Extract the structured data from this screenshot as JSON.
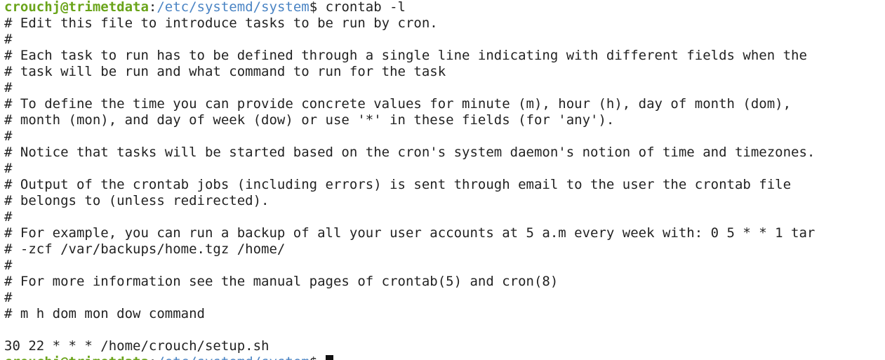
{
  "prompt": {
    "user_host": "crouchj@trimetdata",
    "separator": ":",
    "path": "/etc/systemd/system",
    "symbol": "$",
    "command": "crontab -l"
  },
  "output_lines": [
    "# Edit this file to introduce tasks to be run by cron.",
    "#",
    "# Each task to run has to be defined through a single line indicating with different fields when the",
    "# task will be run and what command to run for the task",
    "#",
    "# To define the time you can provide concrete values for minute (m), hour (h), day of month (dom),",
    "# month (mon), and day of week (dow) or use '*' in these fields (for 'any').",
    "#",
    "# Notice that tasks will be started based on the cron's system daemon's notion of time and timezones.",
    "#",
    "# Output of the crontab jobs (including errors) is sent through email to the user the crontab file",
    "# belongs to (unless redirected).",
    "#",
    "# For example, you can run a backup of all your user accounts at 5 a.m every week with: 0 5 * * 1 tar",
    "# -zcf /var/backups/home.tgz /home/",
    "#",
    "# For more information see the manual pages of crontab(5) and cron(8)",
    "#",
    "# m h dom mon dow command",
    "",
    "30 22 * * * /home/crouch/setup.sh"
  ],
  "colors": {
    "background": "#ffffff",
    "text": "#222222",
    "user_host": "#6aa41a",
    "path": "#4a84c4"
  }
}
